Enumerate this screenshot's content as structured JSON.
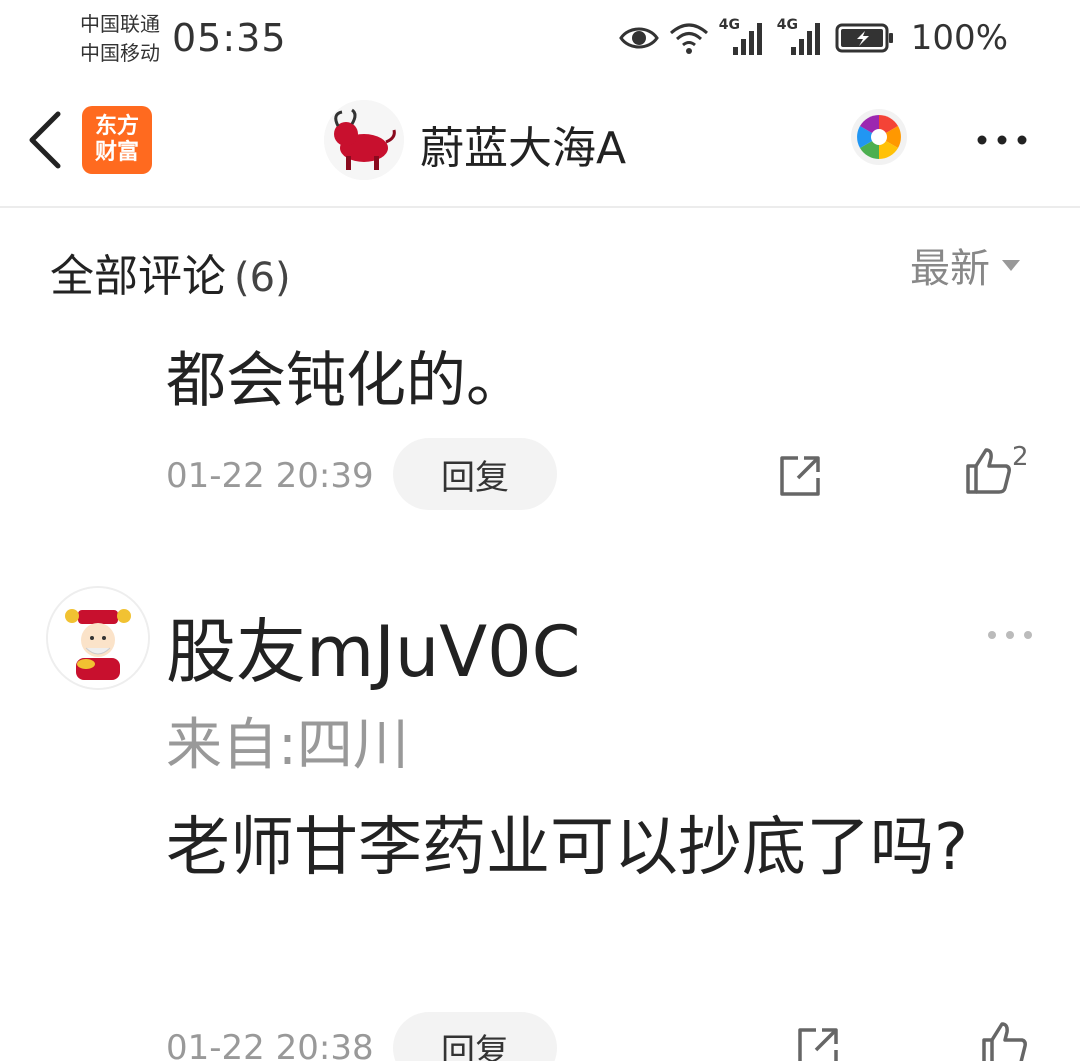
{
  "status_bar": {
    "carrier_1": "中国联通",
    "carrier_2": "中国移动",
    "time": "05:35",
    "network_1": "4G",
    "network_2": "4G",
    "battery": "100%"
  },
  "header": {
    "app_logo_line1": "东方",
    "app_logo_line2": "财富",
    "title": "蔚蓝大海A"
  },
  "comments_section": {
    "title": "全部评论",
    "count": "(6)",
    "sort_label": "最新"
  },
  "comments": [
    {
      "text": "都会钝化的。",
      "time": "01-22 20:39",
      "reply_label": "回复",
      "likes": "2"
    },
    {
      "user": "股友mJuV0C",
      "location": "来自:四川",
      "text": "老师甘李药业可以抄底了吗?",
      "time": "01-22 20:38",
      "reply_label": "回复"
    }
  ],
  "colors": {
    "brand_orange": "#ff6a1f",
    "text_primary": "#222222",
    "text_secondary": "#999999",
    "reply_bg": "#f3f3f3"
  },
  "icons": {
    "status": [
      "eye-icon",
      "wifi-icon",
      "signal-icon",
      "signal-icon",
      "battery-charging-icon"
    ],
    "header": [
      "back-chevron-icon",
      "bull-avatar-icon",
      "color-wheel-icon",
      "more-dots-icon"
    ],
    "comment": [
      "share-icon",
      "thumbs-up-icon",
      "more-dots-icon"
    ]
  }
}
